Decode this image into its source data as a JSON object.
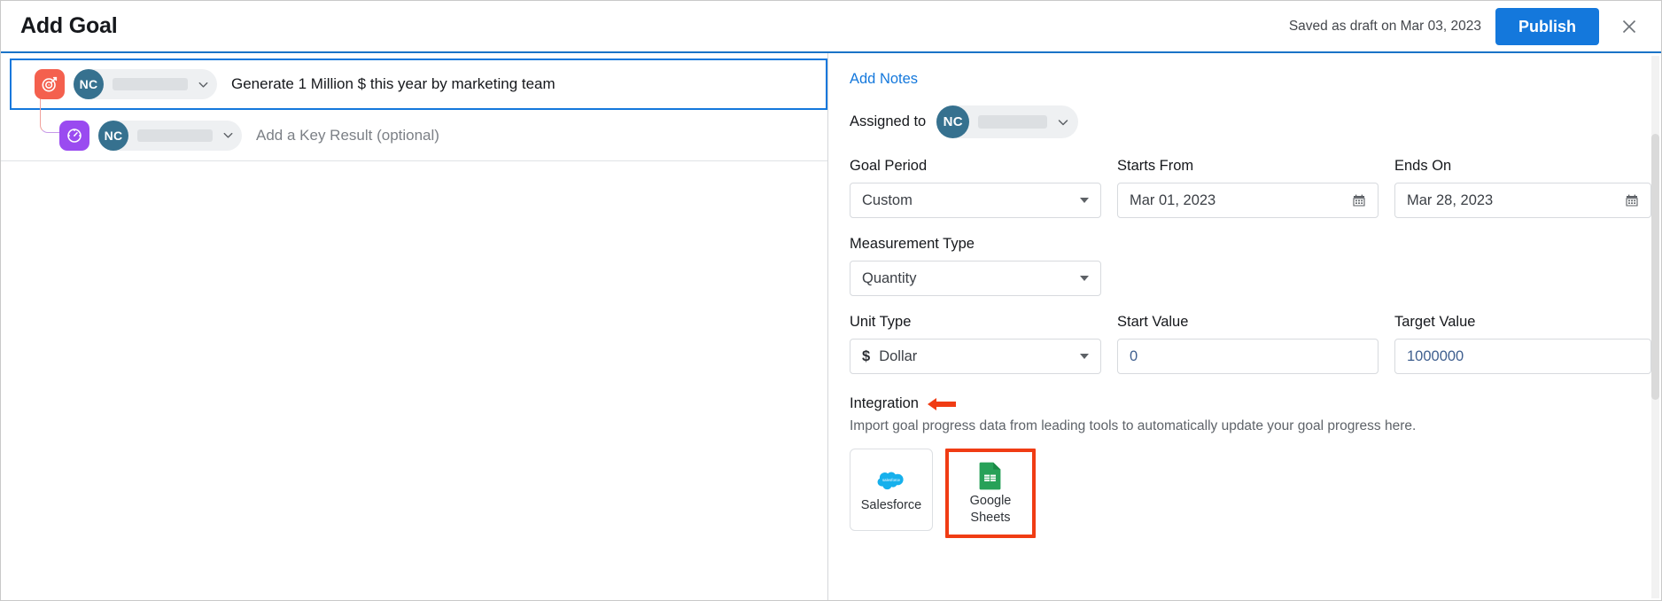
{
  "header": {
    "title": "Add Goal",
    "saved_status": "Saved as draft on Mar 03, 2023",
    "publish_label": "Publish",
    "close_icon": "close-icon"
  },
  "goal_tree": {
    "goal_row": {
      "type_icon": "target-icon",
      "owner_initials": "NC",
      "owner_name_redacted": "",
      "text": "Generate 1 Million $ this year by marketing team"
    },
    "key_result_row": {
      "type_icon": "gauge-icon",
      "owner_initials": "NC",
      "owner_name_redacted": "",
      "placeholder": "Add a Key Result (optional)"
    }
  },
  "details": {
    "add_notes_label": "Add Notes",
    "assigned_to": {
      "label": "Assigned to",
      "owner_initials": "NC",
      "owner_name_redacted": ""
    },
    "fields": {
      "goal_period": {
        "label": "Goal Period",
        "value": "Custom"
      },
      "starts_from": {
        "label": "Starts From",
        "value": "Mar 01, 2023"
      },
      "ends_on": {
        "label": "Ends On",
        "value": "Mar 28, 2023"
      },
      "measurement_type": {
        "label": "Measurement Type",
        "value": "Quantity"
      },
      "unit_type": {
        "label": "Unit Type",
        "value": "Dollar",
        "symbol": "$"
      },
      "start_value": {
        "label": "Start Value",
        "value": "0"
      },
      "target_value": {
        "label": "Target Value",
        "value": "1000000"
      }
    },
    "integration": {
      "title": "Integration",
      "description": "Import goal progress data from leading tools to automatically update your goal progress here.",
      "cards": [
        {
          "name": "Salesforce",
          "icon": "salesforce-cloud-icon",
          "highlighted": false
        },
        {
          "name": "Google\nSheets",
          "label_line1": "Google",
          "label_line2": "Sheets",
          "icon": "google-sheets-icon",
          "highlighted": true
        }
      ]
    }
  },
  "colors": {
    "accent_blue": "#1478dc",
    "goal_icon_bg": "#f4604e",
    "kr_icon_bg": "#9a4bf0",
    "avatar_bg": "#36718f",
    "annotation_red": "#f03c14",
    "sheets_green": "#34a853",
    "salesforce_blue": "#16b0ec"
  }
}
